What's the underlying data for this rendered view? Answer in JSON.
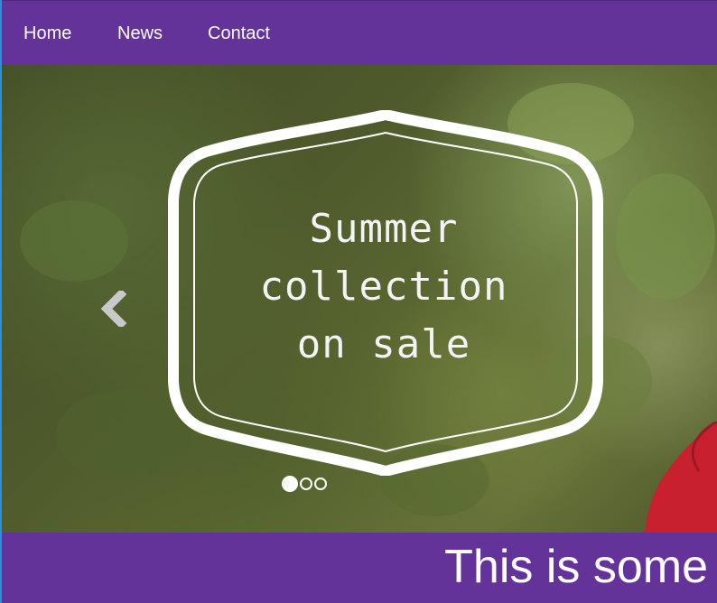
{
  "nav": {
    "items": [
      {
        "label": "Home"
      },
      {
        "label": "News"
      },
      {
        "label": "Contact"
      }
    ]
  },
  "hero": {
    "slide_text_lines": [
      "Summer",
      "collection",
      "on sale"
    ],
    "slides_total": 3,
    "active_slide": 1
  },
  "banner": {
    "text": "This is some"
  },
  "colors": {
    "nav_background": "#64339a",
    "banner_background": "#64339a",
    "text": "#ffffff"
  }
}
